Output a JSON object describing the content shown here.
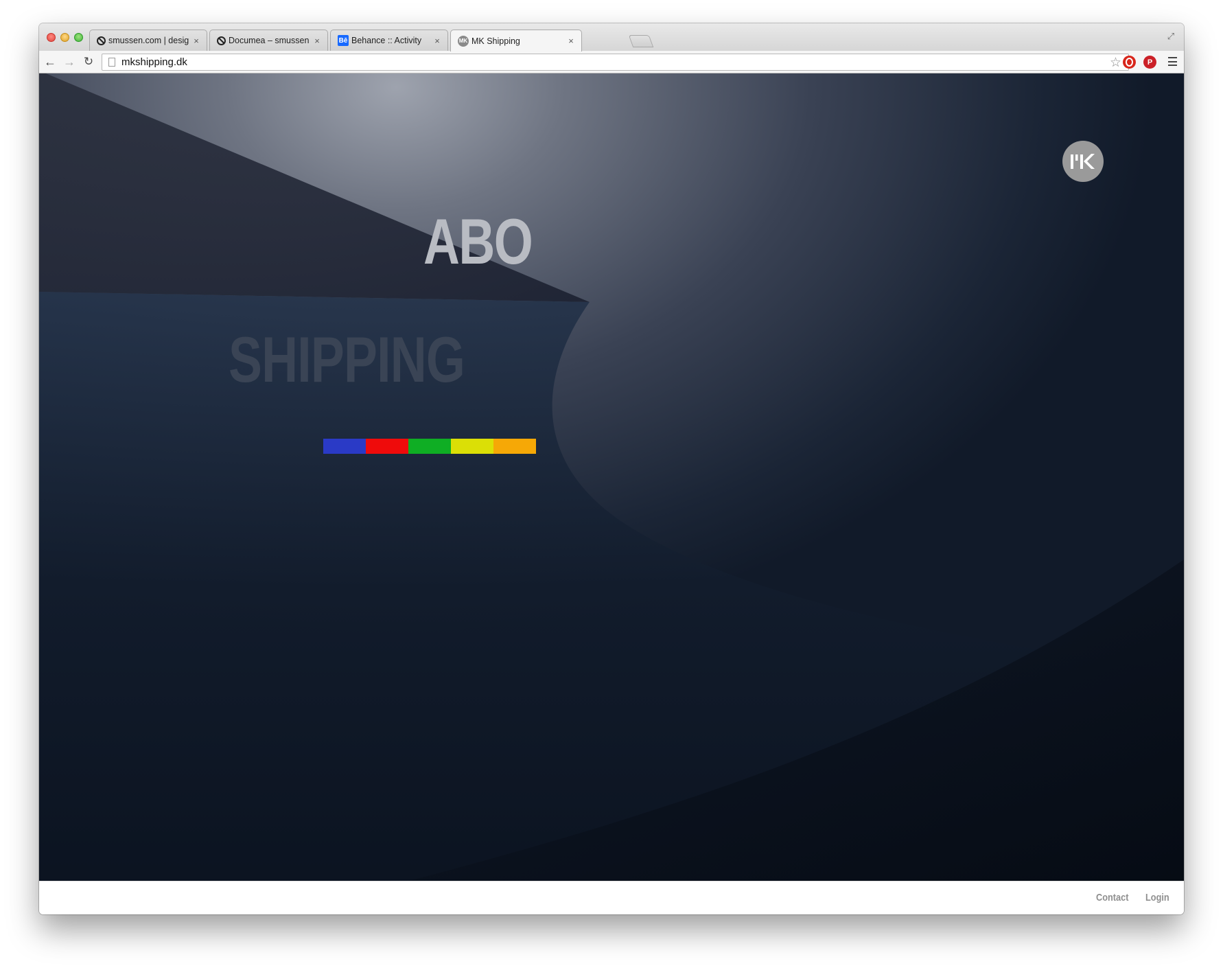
{
  "browser": {
    "tabs": [
      {
        "title": "smussen.com | design adm",
        "favicon": "slashed-circle-icon",
        "active": false
      },
      {
        "title": "Documea – smussen.com",
        "favicon": "slashed-circle-icon",
        "active": false
      },
      {
        "title": "Behance :: Activity",
        "favicon": "behance-icon",
        "favicon_text": "Bē",
        "active": false
      },
      {
        "title": "MK Shipping",
        "favicon": "mk-icon",
        "favicon_text": "MK",
        "active": true
      }
    ],
    "url": "mkshipping.dk"
  },
  "page": {
    "logo_text": "MK",
    "headline_top": "ABO",
    "headline_bottom": "SHIPPING",
    "color_bar": [
      "#2a3ac6",
      "#ef0b0b",
      "#0fae24",
      "#dbdf06",
      "#f6a806"
    ]
  },
  "footer": {
    "contact": "Contact",
    "login": "Login"
  }
}
